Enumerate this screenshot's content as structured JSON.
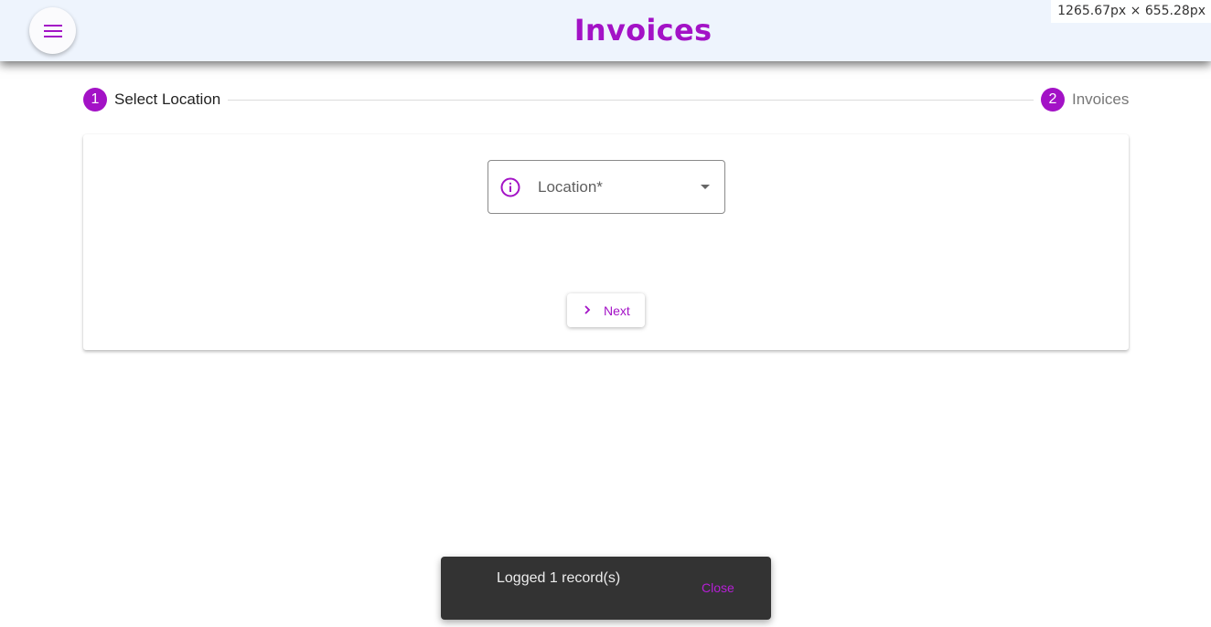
{
  "header": {
    "title": "Invoices",
    "menu_icon": "menu-icon"
  },
  "dimension_readout": "1265.67px × 655.28px",
  "stepper": {
    "steps": [
      {
        "number": "1",
        "label": "Select Location",
        "state": "active"
      },
      {
        "number": "2",
        "label": "Invoices",
        "state": "inactive"
      }
    ]
  },
  "form": {
    "location_field": {
      "label": "Location*",
      "value": "",
      "icon": "info-icon"
    },
    "next_button": {
      "label": "Next",
      "icon": "chevron-right-icon"
    }
  },
  "snackbar": {
    "message": "Logged 1 record(s)",
    "action_label": "Close"
  },
  "colors": {
    "accent": "#a312c6",
    "topbar_background": "#eef4fd",
    "snackbar_background": "#333333"
  }
}
